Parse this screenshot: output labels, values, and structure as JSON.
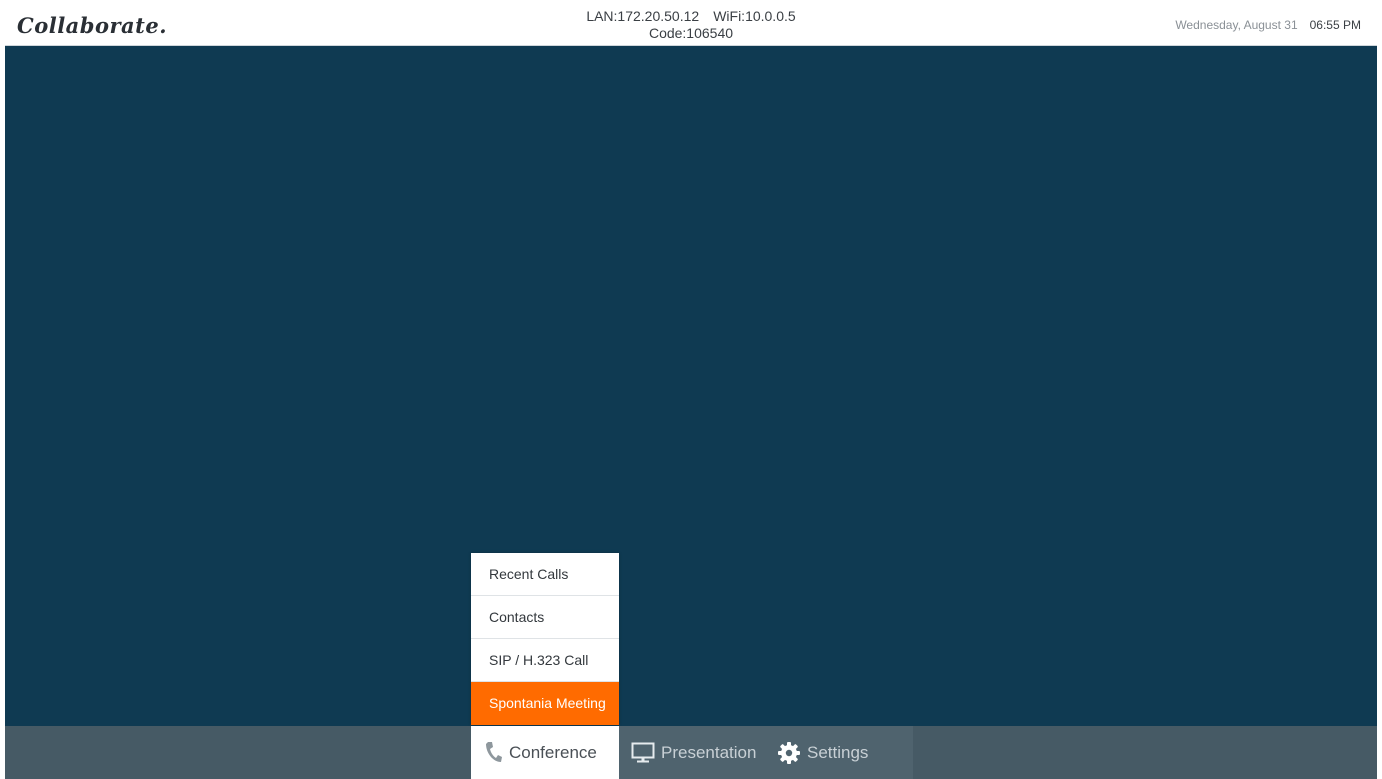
{
  "header": {
    "logo": "Collaborate.",
    "lan": "LAN:172.20.50.12",
    "wifi": "WiFi:10.0.0.5",
    "code": "Code:106540",
    "date": "Wednesday, August 31",
    "time": "06:55 PM"
  },
  "conference_menu": {
    "items": [
      {
        "label": "Recent Calls"
      },
      {
        "label": "Contacts"
      },
      {
        "label": "SIP / H.323 Call"
      },
      {
        "label": "Spontania Meeting",
        "active": true
      }
    ]
  },
  "tabs": {
    "conference": {
      "label": "Conference",
      "icon": "phone-icon"
    },
    "presentation": {
      "label": "Presentation",
      "icon": "monitor-icon"
    },
    "settings": {
      "label": "Settings",
      "icon": "gear-icon"
    }
  },
  "colors": {
    "background": "#0f3a52",
    "bottom_bar": "#465a65",
    "accent": "#ff6b00"
  }
}
